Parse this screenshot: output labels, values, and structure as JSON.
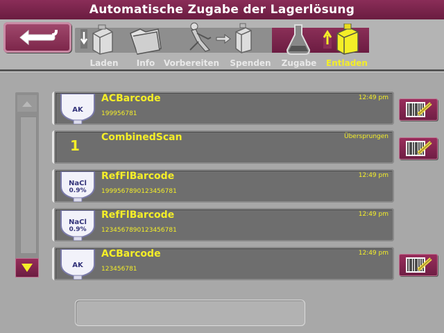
{
  "window": {
    "title": "Automatische Zugabe der Lagerlösung"
  },
  "toolbar": {
    "steps": [
      {
        "label": "Laden",
        "icon": "load-cartridge-icon",
        "active": false
      },
      {
        "label": "Info",
        "icon": "info-folder-icon",
        "active": false
      },
      {
        "label": "Vorbereiten",
        "icon": "prepare-icon",
        "active": false
      },
      {
        "label": "Spenden",
        "icon": "dispense-icon",
        "active": false
      },
      {
        "label": "Zugabe",
        "icon": "flask-icon",
        "active": false
      },
      {
        "label": "Entladen",
        "icon": "unload-cartridge-icon",
        "active": true
      }
    ],
    "colors": {
      "active_step": "#7a2448",
      "active_text": "#f4ee28"
    }
  },
  "items": [
    {
      "bag_label": "AK",
      "name": "ACBarcode",
      "code": "199956781",
      "time": "12:49 pm",
      "has_scan_button": true
    },
    {
      "number": "1",
      "name": "CombinedScan",
      "code": "",
      "time": "Übersprungen",
      "has_scan_button": true
    },
    {
      "bag_label": "NaCl 0.9%",
      "bag_line1": "NaCl",
      "bag_line2": "0.9%",
      "name": "RefFlBarcode",
      "code": "19995678901234567​81",
      "time": "12:49 pm",
      "has_scan_button": false
    },
    {
      "bag_label": "NaCl 0.9%",
      "bag_line1": "NaCl",
      "bag_line2": "0.9%",
      "name": "RefFlBarcode",
      "code": "1234567890123456781",
      "time": "12:49 pm",
      "has_scan_button": false
    },
    {
      "bag_label": "AK",
      "name": "ACBarcode",
      "code": "123456781",
      "time": "12:49 pm",
      "has_scan_button": true
    }
  ],
  "message": ""
}
